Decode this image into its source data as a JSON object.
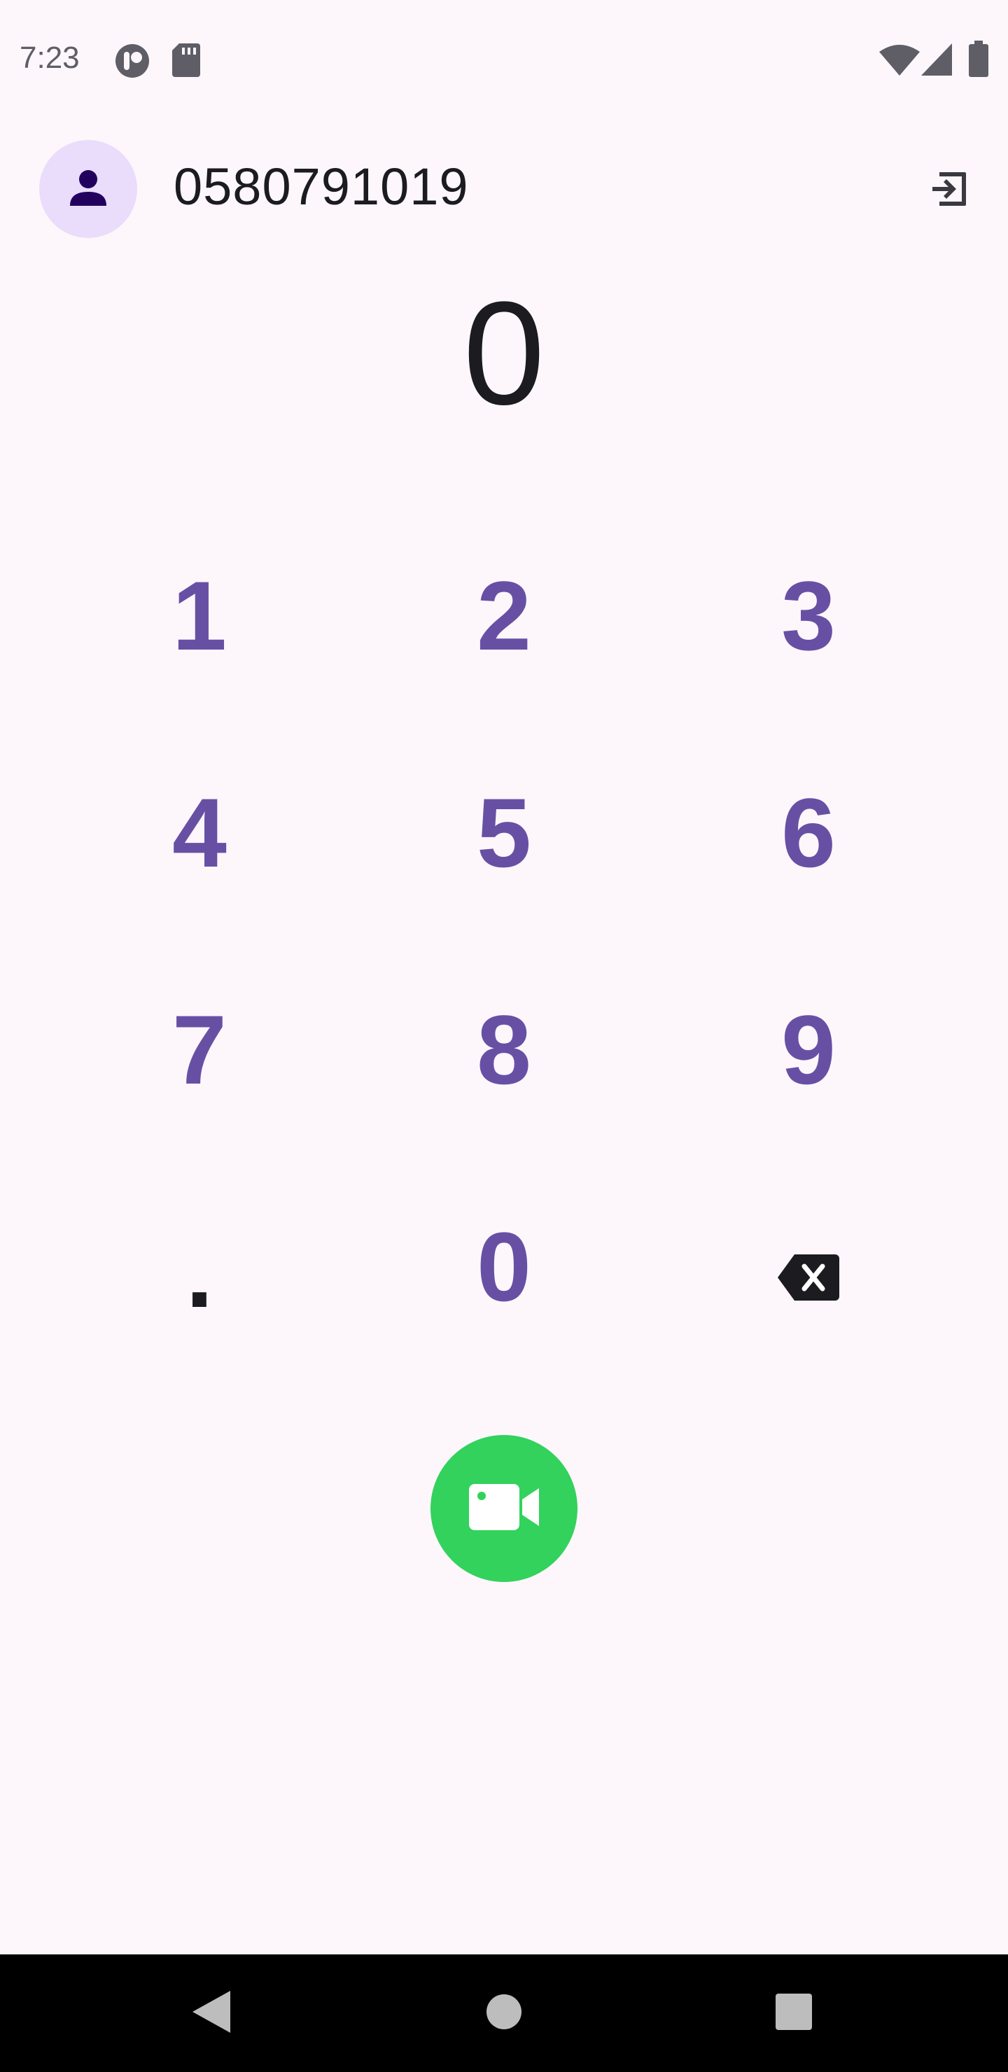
{
  "status_bar": {
    "time": "7:23",
    "icons": [
      "notification-app-icon",
      "sd-card-icon",
      "wifi-icon",
      "cellular-signal-icon",
      "battery-icon"
    ]
  },
  "header": {
    "avatar_icon": "person-icon",
    "phone_number": "0580791019",
    "exit_icon": "exit-to-app-icon"
  },
  "display": {
    "value": "0"
  },
  "keypad": {
    "keys": [
      "1",
      "2",
      "3",
      "4",
      "5",
      "6",
      "7",
      "8",
      "9",
      ".",
      "0"
    ],
    "backspace_icon": "backspace-icon"
  },
  "call_button": {
    "icon": "video-camera-icon",
    "color": "#32D25C"
  },
  "navigation_bar": {
    "icons": [
      "back-icon",
      "home-icon",
      "recents-icon"
    ]
  },
  "colors": {
    "background": "#FDF7FC",
    "accent": "#6750A4",
    "avatar_bg": "#E9DDFB"
  }
}
